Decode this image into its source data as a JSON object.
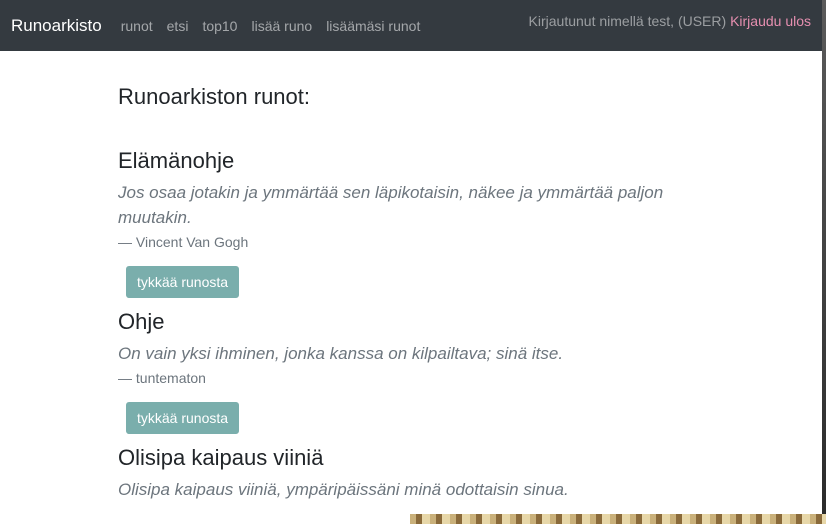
{
  "navbar": {
    "brand": "Runoarkisto",
    "links": [
      "runot",
      "etsi",
      "top10",
      "lisää runo",
      "lisäämäsi runot"
    ],
    "login_status": "Kirjautunut nimellä test, (USER)",
    "logout_label": "Kirjaudu ulos"
  },
  "main": {
    "title": "Runoarkiston runot:",
    "poems": [
      {
        "title": "Elämänohje",
        "text": "Jos osaa jotakin ja ymmärtää sen läpikotaisin, näkee ja ymmärtää paljon muutakin.",
        "author": "Vincent Van Gogh",
        "like_label": "tykkää runosta"
      },
      {
        "title": "Ohje",
        "text": "On vain yksi ihminen, jonka kanssa on kilpailtava; sinä itse.",
        "author": "tuntematon",
        "like_label": "tykkää runosta"
      },
      {
        "title": "Olisipa kaipaus viiniä",
        "text": "Olisipa kaipaus viiniä, ympäripäissäni minä odottaisin sinua."
      }
    ]
  },
  "colors": {
    "navbar": "#343a40",
    "like_button": "#7aaeac",
    "logout_link": "#e68fb0"
  }
}
